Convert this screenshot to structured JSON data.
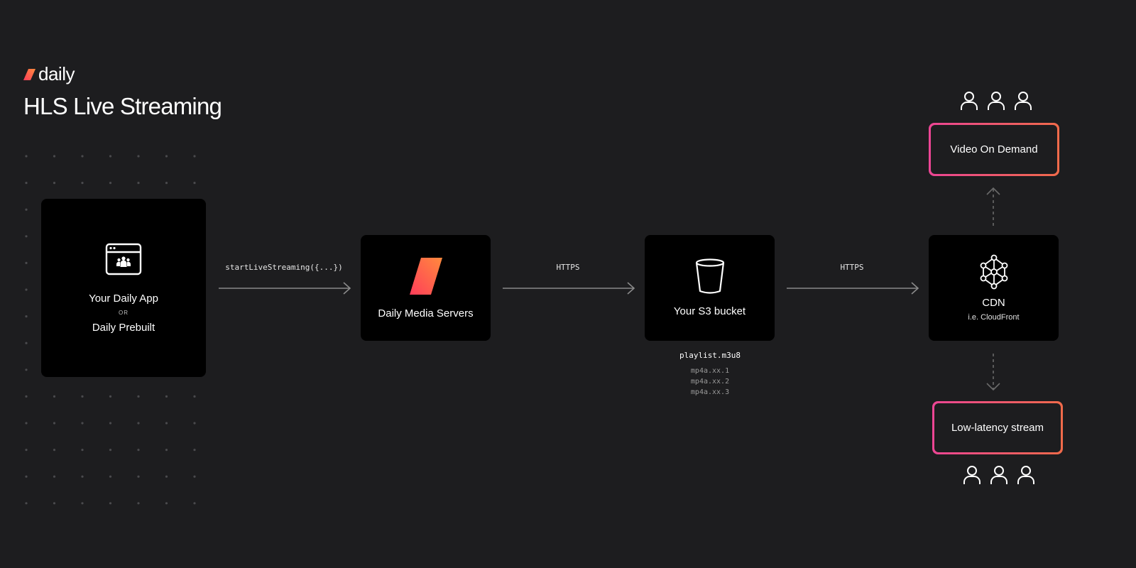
{
  "header": {
    "logo_text": "daily",
    "title": "HLS Live Streaming"
  },
  "nodes": {
    "app": {
      "label_1": "Your Daily App",
      "or": "OR",
      "label_2": "Daily Prebuilt",
      "icon": "browser-window-users-icon"
    },
    "media_servers": {
      "label": "Daily Media Servers",
      "icon": "daily-slash-logo"
    },
    "s3": {
      "label": "Your S3 bucket",
      "icon": "bucket-icon"
    },
    "cdn": {
      "label": "CDN",
      "sub": "i.e. CloudFront",
      "icon": "network-nodes-icon"
    },
    "vod": {
      "label": "Video On Demand"
    },
    "low_latency": {
      "label": "Low-latency stream"
    }
  },
  "edges": {
    "app_to_media": "startLiveStreaming({...})",
    "media_to_s3": "HTTPS",
    "s3_to_cdn": "HTTPS"
  },
  "files": {
    "main": "playlist.m3u8",
    "parts": [
      "mp4a.xx.1",
      "mp4a.xx.2",
      "mp4a.xx.3"
    ]
  },
  "colors": {
    "background": "#1d1d1f",
    "card": "#000000",
    "gradient_start": "#ec4594",
    "gradient_end": "#f06a4a",
    "logo_start": "#ff3d5a",
    "logo_end": "#ff8a3d"
  }
}
